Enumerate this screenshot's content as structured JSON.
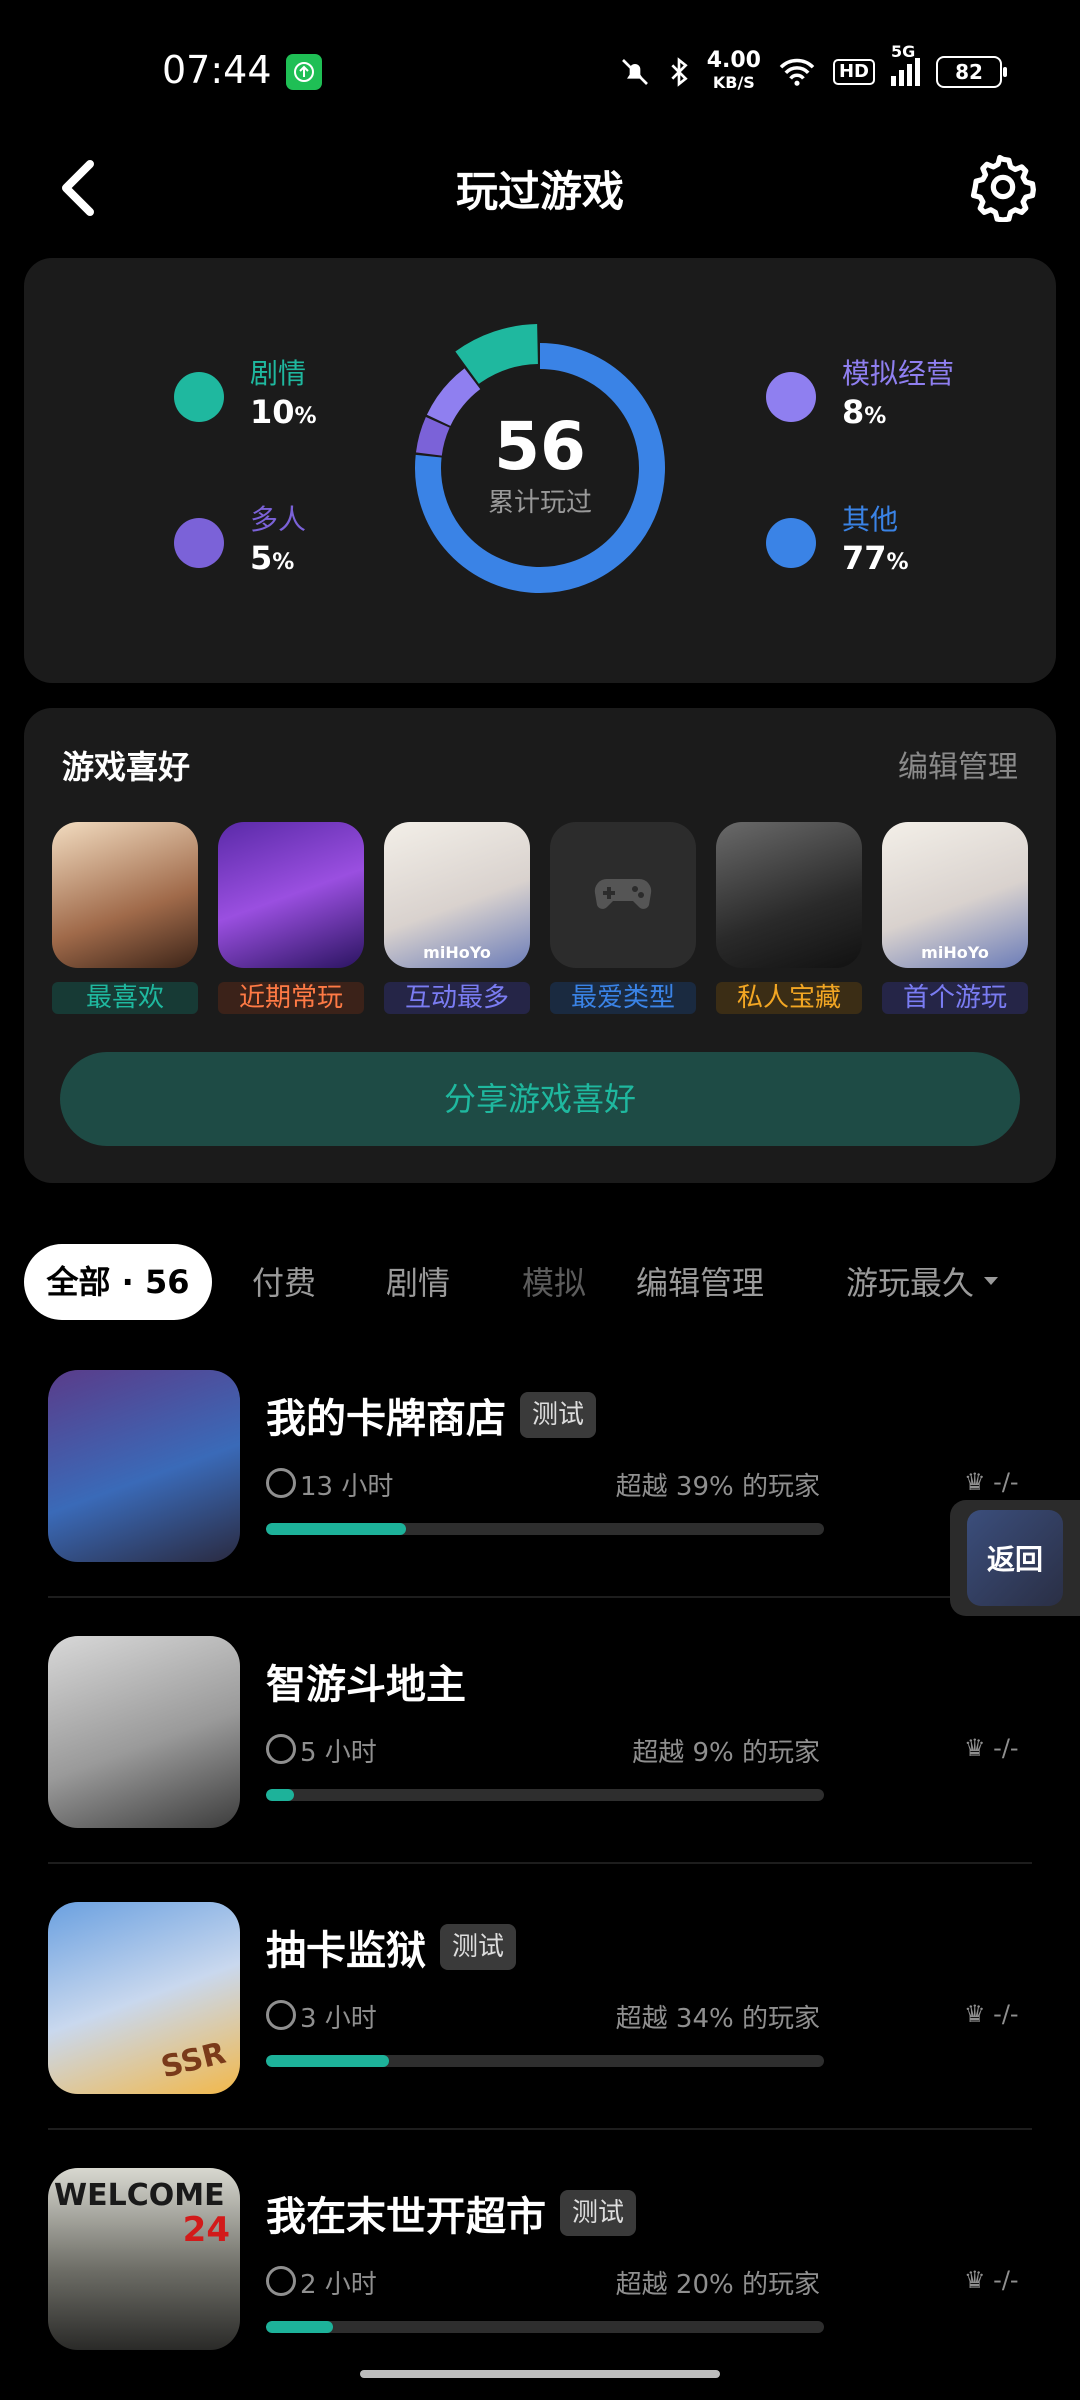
{
  "status_bar": {
    "time": "07:44",
    "net_speed": "4.00",
    "net_unit": "KB/S",
    "hd": "HD",
    "signal": "5G",
    "battery": "82"
  },
  "nav": {
    "title": "玩过游戏"
  },
  "stats": {
    "total": "56",
    "total_label": "累计玩过",
    "categories": [
      {
        "label": "剧情",
        "percent": "10",
        "color": "#1fb89f",
        "icon": "story-icon"
      },
      {
        "label": "多人",
        "percent": "5",
        "color": "#7b62d8",
        "icon": "multiplayer-icon"
      },
      {
        "label": "模拟经营",
        "percent": "8",
        "color": "#8f7ff0",
        "icon": "simulation-icon"
      },
      {
        "label": "其他",
        "percent": "77",
        "color": "#3a83e6",
        "icon": "gamepad-icon"
      }
    ],
    "pct_unit": "%"
  },
  "preferences": {
    "title": "游戏喜好",
    "edit": "编辑管理",
    "items": [
      {
        "tag": "最喜欢",
        "tag_color": "#1fb89f",
        "tag_bg": "#173a35"
      },
      {
        "tag": "近期常玩",
        "tag_color": "#ff7a45",
        "tag_bg": "#3b2219"
      },
      {
        "tag": "互动最多",
        "tag_color": "#7a7cf2",
        "tag_bg": "#252547"
      },
      {
        "tag": "最爱类型",
        "tag_color": "#3a83e6",
        "tag_bg": "#1a2a40"
      },
      {
        "tag": "私人宝藏",
        "tag_color": "#f2a623",
        "tag_bg": "#3b2d15"
      },
      {
        "tag": "首个游玩",
        "tag_color": "#7a7cf2",
        "tag_bg": "#252547"
      }
    ],
    "share": "分享游戏喜好"
  },
  "tabs": {
    "all": "全部 · 56",
    "paid": "付费",
    "story": "剧情",
    "sim": "模拟",
    "edit": "编辑管理",
    "sort": "游玩最久"
  },
  "games": [
    {
      "name": "我的卡牌商店",
      "badge": "测试",
      "time": "13 小时",
      "beat": "超越 39% 的玩家",
      "progress": 0.25,
      "rank": "-/-"
    },
    {
      "name": "智游斗地主",
      "badge": "",
      "time": "5 小时",
      "beat": "超越 9% 的玩家",
      "progress": 0.05,
      "rank": "-/-"
    },
    {
      "name": "抽卡监狱",
      "badge": "测试",
      "time": "3 小时",
      "beat": "超越 34% 的玩家",
      "progress": 0.22,
      "rank": "-/-"
    },
    {
      "name": "我在末世开超市",
      "badge": "测试",
      "time": "2 小时",
      "beat": "超越 20% 的玩家",
      "progress": 0.12,
      "rank": "-/-"
    }
  ],
  "float": {
    "label": "返回"
  },
  "icon_texts": {
    "welcome": "WELCOME",
    "welcome_num": "24",
    "ssr": "SSR",
    "mihoyo": "miHoYo"
  }
}
